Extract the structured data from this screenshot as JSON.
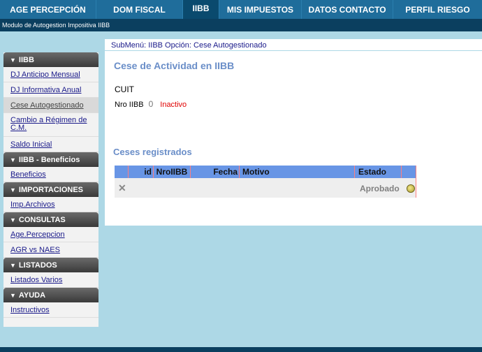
{
  "topnav": {
    "tabs": [
      {
        "label": "AGE PERCEPCIÓN",
        "active": false
      },
      {
        "label": "DOM FISCAL",
        "active": false
      },
      {
        "label": "IIBB",
        "active": true
      },
      {
        "label": "MIS IMPUESTOS",
        "active": false
      },
      {
        "label": "DATOS CONTACTO",
        "active": false
      },
      {
        "label": "PERFIL RIESGO",
        "active": false
      }
    ]
  },
  "subbar": {
    "title": "Modulo de Autogestion Impositiva IIBB"
  },
  "sidebar": {
    "sections": [
      {
        "title": "IIBB",
        "items": [
          "DJ Anticipo Mensual",
          "DJ Informativa Anual",
          "Cese Autogestionado",
          "Cambio a Régimen de C.M.",
          "Saldo Inicial"
        ]
      },
      {
        "title": "IIBB - Beneficios",
        "items": [
          "Beneficios"
        ]
      },
      {
        "title": "IMPORTACIONES",
        "items": [
          "Imp.Archivos"
        ]
      },
      {
        "title": "CONSULTAS",
        "items": [
          "Age.Percepcion",
          "AGR vs NAES"
        ]
      },
      {
        "title": "LISTADOS",
        "items": [
          "Listados Varios"
        ]
      },
      {
        "title": "AYUDA",
        "items": [
          "Instructivos"
        ]
      }
    ]
  },
  "main": {
    "submenu": "SubMenú: IIBB Opción: Cese Autogestionado",
    "heading": "Cese de Actividad en IIBB",
    "cuit_label": "CUIT",
    "nro_label": "Nro IIBB",
    "nro_value": "0",
    "nro_state": "Inactivo",
    "ceses_heading": "Ceses registrados",
    "grid": {
      "columns": [
        "id",
        "NroIIBB",
        "Fecha",
        "Motivo",
        "Estado"
      ],
      "rows": [
        {
          "id": "",
          "nro": "",
          "fecha": "",
          "motivo": "",
          "estado": "Aprobado"
        }
      ]
    }
  },
  "colors": {
    "nav_bg": "#1f6d9b",
    "nav_active": "#0a4a6e",
    "page_bg": "#add8e6",
    "heading_blue": "#6a8ec8",
    "inactive_red": "#e00000",
    "grid_head": "#6895e5"
  },
  "icons": {
    "section_toggle": "triangle-down-icon",
    "delete": "close-icon",
    "status": "status-dot-icon"
  }
}
